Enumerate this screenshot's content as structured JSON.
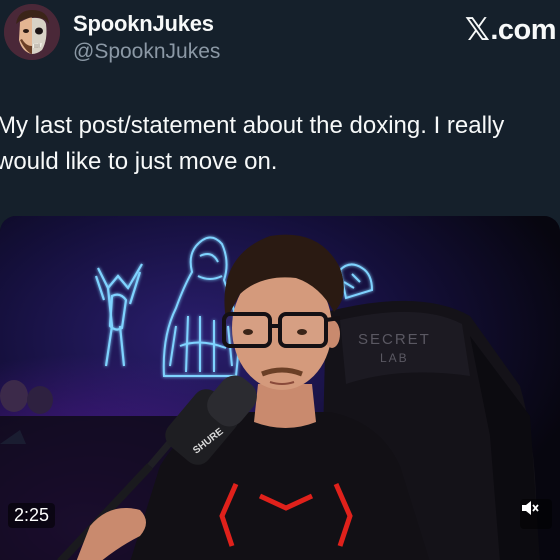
{
  "author": {
    "display_name": "SpooknJukes",
    "handle": "@SpooknJukes",
    "avatar_icon": "avatar-half-skull-face"
  },
  "brand": {
    "logo_glyph": "𝕏",
    "logo_text": ".com"
  },
  "tweet": {
    "text": "My last post/statement about the doxing. I really\nwould like to just move on."
  },
  "media": {
    "type": "video",
    "timestamp": "2:25",
    "mute_icon": "speaker-muted-icon",
    "overlay_text": {
      "microphone_brand": "SHURE",
      "chair_brand_line1": "SECRET",
      "chair_brand_line2": "LAB"
    }
  },
  "colors": {
    "background": "#15202b",
    "text_primary": "#f7f9f9",
    "text_secondary": "#8b98a5",
    "neon_blue": "#7fd3ff",
    "shirt_red": "#e0211b"
  }
}
